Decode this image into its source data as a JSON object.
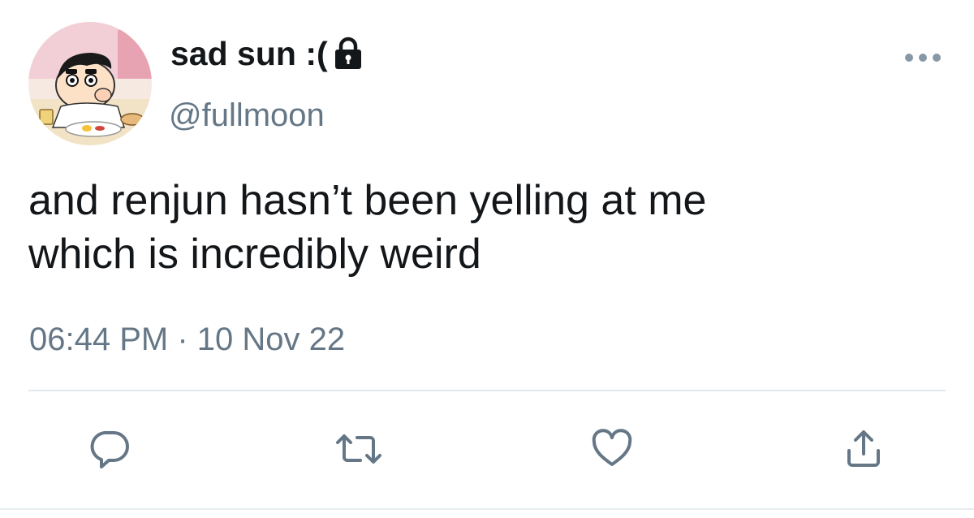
{
  "tweet": {
    "display_name": "sad sun :(",
    "handle": "@fullmoon",
    "body_lines": [
      "and renjun hasn’t been yelling at me",
      "which is incredibly weird"
    ],
    "timestamp": "06:44 PM · 10 Nov 22",
    "protected": true,
    "avatar_description_icon": "cartoon-avatar",
    "actions": [
      {
        "name": "reply",
        "icon": "reply-icon"
      },
      {
        "name": "retweet",
        "icon": "retweet-icon"
      },
      {
        "name": "like",
        "icon": "heart-icon"
      },
      {
        "name": "share",
        "icon": "share-icon"
      }
    ]
  },
  "colors": {
    "text_primary": "#14171a",
    "text_secondary": "#657786",
    "icon": "#657786",
    "divider": "#e1e8ed",
    "background": "#ffffff"
  }
}
